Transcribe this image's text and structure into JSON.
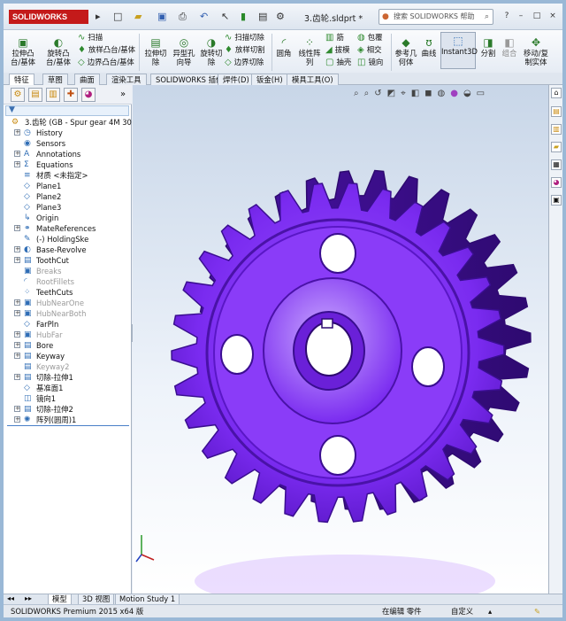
{
  "app": {
    "logo": "SOLIDWORKS",
    "document_title": "3.齿轮.sldprt *",
    "help_search_placeholder": "搜索 SOLIDWORKS 帮助"
  },
  "command_manager": {
    "big_buttons": [
      {
        "label": "拉伸凸\n台/基体",
        "icon": "extrude-boss-icon"
      },
      {
        "label": "旋转凸\n台/基体",
        "icon": "revolve-boss-icon"
      },
      {
        "label": "拉伸切\n除",
        "icon": "extrude-cut-icon"
      },
      {
        "label": "异型孔\n向导",
        "icon": "hole-wizard-icon"
      },
      {
        "label": "旋转切\n除",
        "icon": "revolve-cut-icon"
      },
      {
        "label": "圆角",
        "icon": "fillet-icon"
      },
      {
        "label": "线性阵\n列",
        "icon": "linear-pattern-icon"
      },
      {
        "label": "参考几\n何体",
        "icon": "reference-geometry-icon"
      },
      {
        "label": "曲线",
        "icon": "curves-icon"
      },
      {
        "label": "Instant3D",
        "icon": "instant3d-icon"
      },
      {
        "label": "分割",
        "icon": "split-icon"
      },
      {
        "label": "组合",
        "icon": "combine-icon"
      },
      {
        "label": "移动/复\n制实体",
        "icon": "move-copy-icon"
      }
    ],
    "small_buttons_col1": [
      "扫描",
      "放样凸台/基体",
      "边界凸台/基体"
    ],
    "small_buttons_col2": [
      "扫描切除",
      "放样切割",
      "边界切除"
    ],
    "small_buttons_col3": [
      "筋",
      "拔模",
      "抽壳"
    ],
    "small_buttons_col4": [
      "包覆",
      "相交",
      "镜向"
    ]
  },
  "tabs": [
    "特征",
    "草图",
    "曲面",
    "渲染工具",
    "SOLIDWORKS 插件",
    "焊件(D)",
    "钣金(H)",
    "模具工具(O)"
  ],
  "feature_tree": {
    "root": "3.齿轮  (GB - Spur gear 4M 30",
    "items": [
      {
        "label": "History",
        "expand": true,
        "icon": "history-icon",
        "grey": false
      },
      {
        "label": "Sensors",
        "expand": false,
        "icon": "sensor-icon",
        "grey": false
      },
      {
        "label": "Annotations",
        "expand": true,
        "icon": "annotations-icon",
        "grey": false
      },
      {
        "label": "Equations",
        "expand": true,
        "icon": "equations-icon",
        "grey": false
      },
      {
        "label": "材质 <未指定>",
        "expand": false,
        "icon": "material-icon",
        "grey": false
      },
      {
        "label": "Plane1",
        "expand": false,
        "icon": "plane-icon",
        "grey": false
      },
      {
        "label": "Plane2",
        "expand": false,
        "icon": "plane-icon",
        "grey": false
      },
      {
        "label": "Plane3",
        "expand": false,
        "icon": "plane-icon",
        "grey": false
      },
      {
        "label": "Origin",
        "expand": false,
        "icon": "origin-icon",
        "grey": false
      },
      {
        "label": "MateReferences",
        "expand": true,
        "icon": "mate-references-icon",
        "grey": false
      },
      {
        "label": "(-) HoldingSke",
        "expand": false,
        "icon": "sketch-icon",
        "grey": false
      },
      {
        "label": "Base-Revolve",
        "expand": true,
        "icon": "revolve-feature-icon",
        "grey": false
      },
      {
        "label": "ToothCut",
        "expand": true,
        "icon": "cut-feature-icon",
        "grey": false
      },
      {
        "label": "Breaks",
        "expand": false,
        "icon": "feature-icon",
        "grey": true
      },
      {
        "label": "RootFillets",
        "expand": false,
        "icon": "fillet-feature-icon",
        "grey": true
      },
      {
        "label": "TeethCuts",
        "expand": false,
        "icon": "pattern-feature-icon",
        "grey": false
      },
      {
        "label": "HubNearOne",
        "expand": true,
        "icon": "feature-icon",
        "grey": true
      },
      {
        "label": "HubNearBoth",
        "expand": true,
        "icon": "feature-icon",
        "grey": true
      },
      {
        "label": "FarPln",
        "expand": false,
        "icon": "plane-icon",
        "grey": false
      },
      {
        "label": "HubFar",
        "expand": true,
        "icon": "feature-icon",
        "grey": true
      },
      {
        "label": "Bore",
        "expand": true,
        "icon": "cut-feature-icon",
        "grey": false
      },
      {
        "label": "Keyway",
        "expand": true,
        "icon": "cut-feature-icon",
        "grey": false
      },
      {
        "label": "Keyway2",
        "expand": false,
        "icon": "cut-feature-icon",
        "grey": true
      },
      {
        "label": "切除-拉伸1",
        "expand": true,
        "icon": "cut-feature-icon",
        "grey": false
      },
      {
        "label": "基准面1",
        "expand": false,
        "icon": "plane-icon",
        "grey": false
      },
      {
        "label": "镜向1",
        "expand": false,
        "icon": "mirror-feature-icon",
        "grey": false
      },
      {
        "label": "切除-拉伸2",
        "expand": true,
        "icon": "cut-feature-icon",
        "grey": false
      },
      {
        "label": "阵列(圆周)1",
        "expand": true,
        "icon": "circular-pattern-icon",
        "grey": false
      }
    ]
  },
  "bottom_tabs": [
    "模型",
    "3D 视图",
    "Motion Study 1"
  ],
  "status": {
    "product": "SOLIDWORKS Premium 2015 x64 版",
    "mode": "在编辑 零件",
    "units": "自定义"
  },
  "colors": {
    "gear": "#7a2bf0",
    "gear_dark": "#4a12a8",
    "accent": "#c41a1a"
  }
}
